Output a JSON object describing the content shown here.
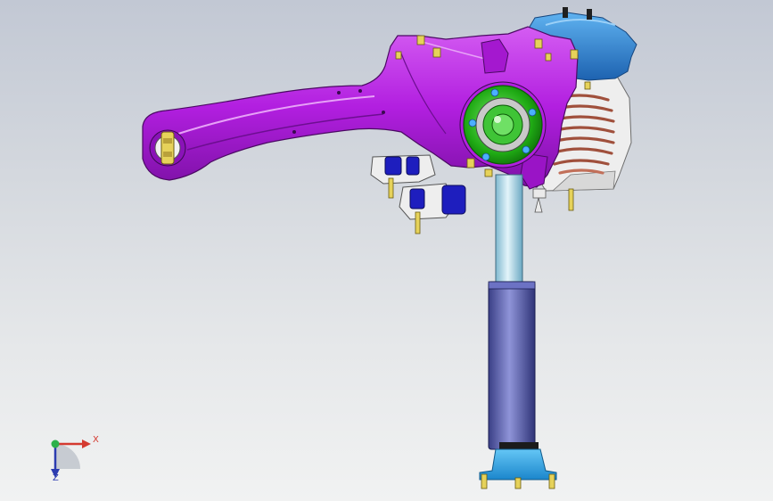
{
  "viewport": {
    "background_top": "#c2c8d4",
    "background_bottom": "#f1f2f2"
  },
  "model": {
    "parts": [
      {
        "name": "trailing-arm",
        "color": "#b21fe0"
      },
      {
        "name": "wheel-hub",
        "color": "#1faa14"
      },
      {
        "name": "top-mount",
        "color": "#2f86d8"
      },
      {
        "name": "coil-spring",
        "color": "#a0503c"
      },
      {
        "name": "damper-rod",
        "color": "#b5ddec"
      },
      {
        "name": "damper-body",
        "color": "#5a5fb0"
      },
      {
        "name": "lower-mount",
        "color": "#33a8e8"
      },
      {
        "name": "bushings",
        "color": "#1e1ebe"
      },
      {
        "name": "bolts",
        "color": "#e6d25a"
      }
    ]
  },
  "triad": {
    "x_label": "X",
    "z_label": "Z",
    "x_color": "#d43a30",
    "y_color": "#2db14a",
    "z_color": "#2c3cb0"
  }
}
